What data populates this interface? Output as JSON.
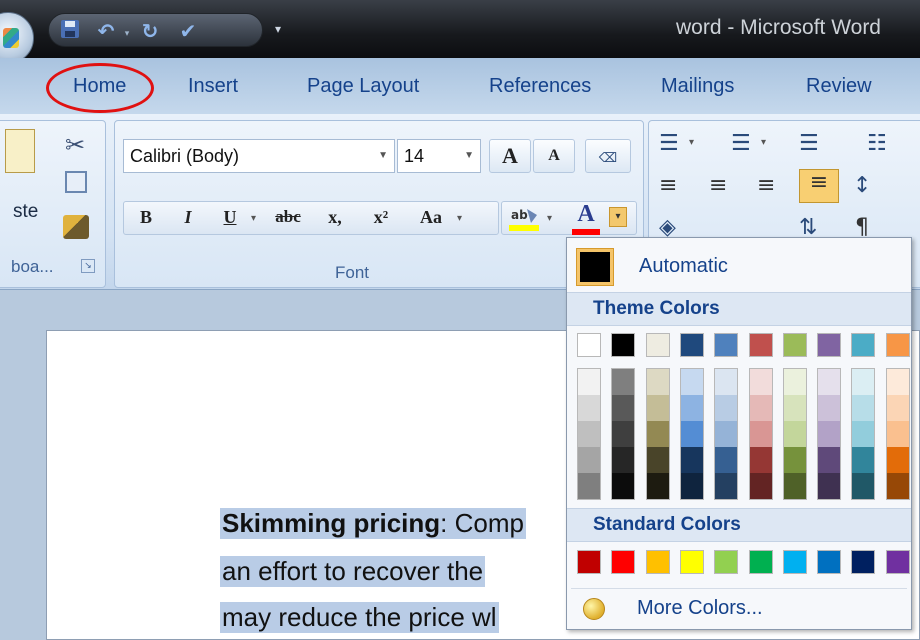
{
  "window": {
    "title": "word - Microsoft Word"
  },
  "tabs": [
    {
      "label": "Home"
    },
    {
      "label": "Insert"
    },
    {
      "label": "Page Layout"
    },
    {
      "label": "References"
    },
    {
      "label": "Mailings"
    },
    {
      "label": "Review"
    }
  ],
  "clipboard": {
    "paste_label": "ste",
    "group_label": "boa..."
  },
  "font_group": {
    "font_name": "Calibri (Body)",
    "font_size": "14",
    "group_label": "Font",
    "bold": "B",
    "italic": "I",
    "underline": "U",
    "strike": "abc",
    "subscript": "x,",
    "superscript": "x²",
    "change_case": "Aa",
    "grow": "A",
    "shrink": "A",
    "font_color": "A"
  },
  "font_color_menu": {
    "automatic_label": "Automatic",
    "theme_header": "Theme Colors",
    "standard_header": "Standard Colors",
    "more_label": "More Colors...",
    "theme_colors": [
      "#ffffff",
      "#000000",
      "#eeece1",
      "#1f497d",
      "#4f81bd",
      "#c0504d",
      "#9bbb59",
      "#8064a2",
      "#4bacc6",
      "#f79646"
    ],
    "theme_shades": [
      [
        "#f2f2f2",
        "#d8d8d8",
        "#bfbfbf",
        "#a5a5a5",
        "#7f7f7f"
      ],
      [
        "#7f7f7f",
        "#595959",
        "#3f3f3f",
        "#262626",
        "#0c0c0c"
      ],
      [
        "#ddd9c3",
        "#c4bd97",
        "#938953",
        "#494429",
        "#1d1b10"
      ],
      [
        "#c6d9f0",
        "#8db3e2",
        "#548dd4",
        "#17365d",
        "#0f243e"
      ],
      [
        "#dbe5f1",
        "#b8cce4",
        "#95b3d7",
        "#366092",
        "#244061"
      ],
      [
        "#f2dcdb",
        "#e5b9b7",
        "#d99694",
        "#953734",
        "#632423"
      ],
      [
        "#ebf1dd",
        "#d7e3bc",
        "#c3d69b",
        "#76923c",
        "#4f6128"
      ],
      [
        "#e5e0ec",
        "#ccc1d9",
        "#b2a2c7",
        "#5f497a",
        "#3f3151"
      ],
      [
        "#dbeef3",
        "#b7dde8",
        "#92cddc",
        "#31859b",
        "#205867"
      ],
      [
        "#fdeada",
        "#fbd5b5",
        "#fac08f",
        "#e36c09",
        "#974806"
      ]
    ],
    "standard_colors": [
      "#c00000",
      "#ff0000",
      "#ffc000",
      "#ffff00",
      "#92d050",
      "#00b050",
      "#00b0f0",
      "#0070c0",
      "#002060",
      "#7030a0"
    ]
  },
  "document": {
    "line1_bold": "Skimming pricing",
    "line1_rest": ":  Comp",
    "line2": "an effort to recover the",
    "line3": "may reduce the price wl"
  },
  "colors": {
    "accent": "#15428b",
    "annotation": "#e01111",
    "selection": "#b9cce6"
  }
}
